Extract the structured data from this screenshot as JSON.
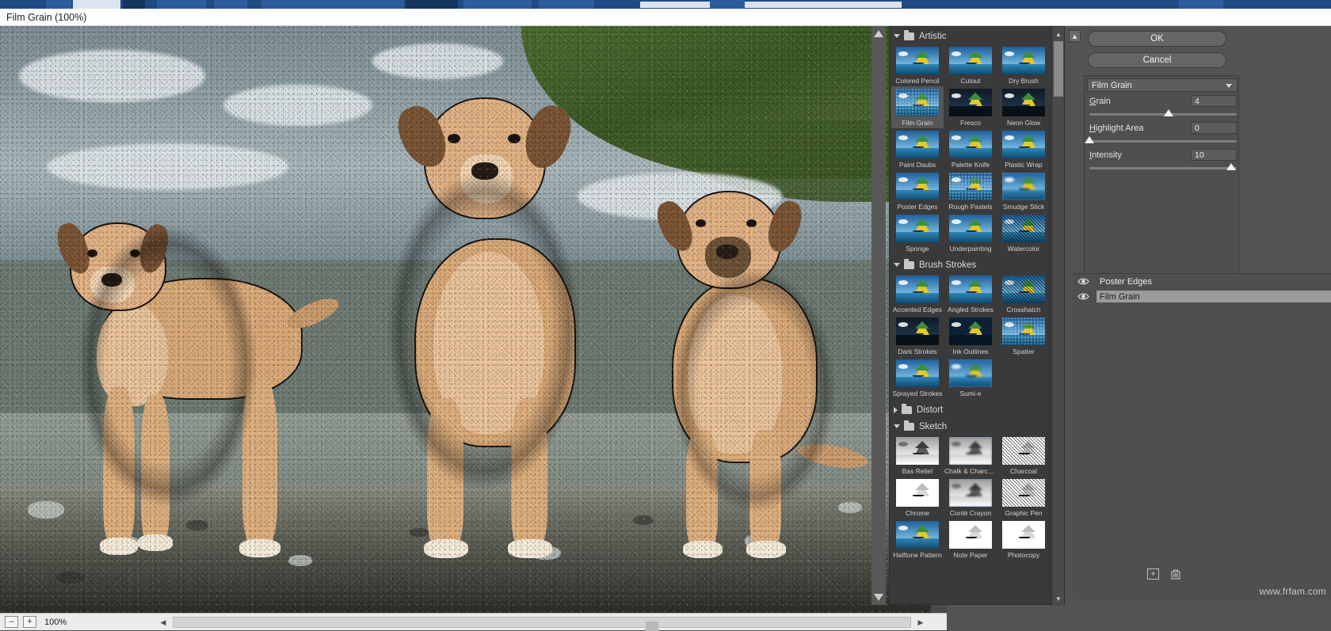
{
  "titlebar": {
    "title": "Film Grain (100%)"
  },
  "preview": {
    "zoom_out_label": "–",
    "zoom_in_label": "+",
    "zoom_value": "100%",
    "scroll_left_icon": "triangle-left-icon",
    "scroll_right_icon": "triangle-right-icon"
  },
  "browser": {
    "categories": [
      {
        "name": "Artistic",
        "expanded": true,
        "filters": [
          {
            "label": "Colored Pencil",
            "style": ""
          },
          {
            "label": "Cutout",
            "style": ""
          },
          {
            "label": "Dry Brush",
            "style": ""
          },
          {
            "label": "Film Grain",
            "style": "grainy",
            "selected": true
          },
          {
            "label": "Fresco",
            "style": "dark"
          },
          {
            "label": "Neon Glow",
            "style": "dark"
          },
          {
            "label": "Paint Daubs",
            "style": ""
          },
          {
            "label": "Palette Knife",
            "style": ""
          },
          {
            "label": "Plastic Wrap",
            "style": ""
          },
          {
            "label": "Poster Edges",
            "style": ""
          },
          {
            "label": "Rough Pastels",
            "style": "grainy"
          },
          {
            "label": "Smudge Stick",
            "style": "blurry"
          },
          {
            "label": "Sponge",
            "style": ""
          },
          {
            "label": "Underpainting",
            "style": ""
          },
          {
            "label": "Watercolor",
            "style": "hatch"
          }
        ]
      },
      {
        "name": "Brush Strokes",
        "expanded": true,
        "filters": [
          {
            "label": "Accented Edges",
            "style": ""
          },
          {
            "label": "Angled Strokes",
            "style": ""
          },
          {
            "label": "Crosshatch",
            "style": "hatch"
          },
          {
            "label": "Dark Strokes",
            "style": "dark"
          },
          {
            "label": "Ink Outlines",
            "style": "inkdark"
          },
          {
            "label": "Spatter",
            "style": "grainy"
          },
          {
            "label": "Sprayed Strokes",
            "style": ""
          },
          {
            "label": "Sumi-e",
            "style": "blurry"
          }
        ]
      },
      {
        "name": "Distort",
        "expanded": false,
        "filters": []
      },
      {
        "name": "Sketch",
        "expanded": true,
        "filters": [
          {
            "label": "Bas Relief",
            "style": "gray"
          },
          {
            "label": "Chalk & Charcoal",
            "style": "gray blurry"
          },
          {
            "label": "Charcoal",
            "style": "white hatch"
          },
          {
            "label": "Chrome",
            "style": "white"
          },
          {
            "label": "Conté Crayon",
            "style": "gray blurry"
          },
          {
            "label": "Graphic Pen",
            "style": "white hatch"
          },
          {
            "label": "Halftone Pattern",
            "style": "checker"
          },
          {
            "label": "Note Paper",
            "style": "white"
          },
          {
            "label": "Photocopy",
            "style": "white"
          }
        ]
      }
    ]
  },
  "settings": {
    "collapse_icon": "collapse-panel-icon",
    "ok_label": "OK",
    "cancel_label": "Cancel",
    "filter_select_value": "Film Grain",
    "filter_select_icon": "chevron-down-icon",
    "sliders": [
      {
        "label_underlined": "G",
        "label_rest": "rain",
        "value": "4",
        "knob_pct": 54
      },
      {
        "label_underlined": "H",
        "label_rest": "ighlight Area",
        "value": "0",
        "knob_pct": 0
      },
      {
        "label_underlined": "I",
        "label_rest": "ntensity",
        "value": "10",
        "knob_pct": 96
      }
    ]
  },
  "effects": {
    "items": [
      {
        "label": "Poster Edges",
        "visible": true,
        "selected": false
      },
      {
        "label": "Film Grain",
        "visible": true,
        "selected": true
      }
    ],
    "new_effect_icon": "new-effect-layer-icon",
    "delete_effect_icon": "trash-icon"
  },
  "watermark": {
    "text": "www.frfam.com"
  }
}
